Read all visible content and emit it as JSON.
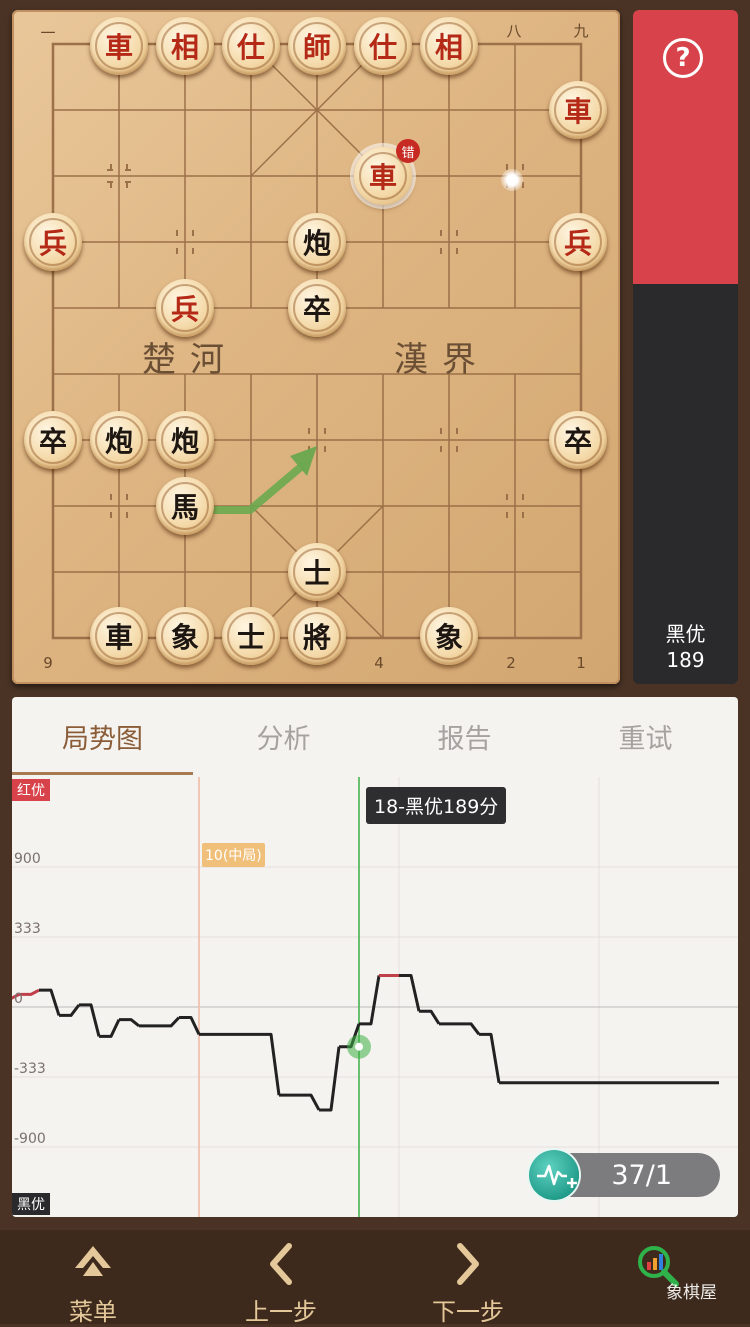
{
  "board": {
    "top_file_labels": [
      "一",
      "八",
      "九"
    ],
    "bottom_file_labels": [
      "9",
      "4",
      "2",
      "1"
    ],
    "river_left": "楚河",
    "river_right": "漢界",
    "error_badge": "错",
    "pieces": {
      "r_top_1": "車",
      "r_top_2": "相",
      "r_top_3": "仕",
      "r_top_4": "師",
      "r_top_5": "仕",
      "r_top_6": "相",
      "r_right_che": "車",
      "r_sel_che": "車",
      "r_left_bing": "兵",
      "r_right_bing": "兵",
      "r_mid_bing": "兵",
      "b_pao_1": "炮",
      "b_zu_1": "卒",
      "b_zu_2": "卒",
      "b_pao_2": "炮",
      "b_pao_3": "炮",
      "b_zu_3": "卒",
      "b_ma": "馬",
      "b_shi_1": "士",
      "b_che": "車",
      "b_xiang_1": "象",
      "b_shi_2": "士",
      "b_jiang": "將",
      "b_xiang_2": "象"
    }
  },
  "sidebar": {
    "help_icon": "?",
    "advantage_label": "黑优",
    "advantage_value": "189",
    "colors": {
      "red": "#d8434b",
      "dark": "#2a2a2c"
    }
  },
  "tabs": [
    "局势图",
    "分析",
    "报告",
    "重试"
  ],
  "chart": {
    "red_adv_tag": "红优",
    "black_adv_tag": "黑优",
    "y_labels": [
      "900",
      "333",
      "0",
      "-333",
      "-900"
    ],
    "tooltip": "18-黑优189分",
    "phase_tag": "10(中局)",
    "counter": "37/1",
    "colors": {
      "red_line": "#c0404a",
      "black_line": "#222222",
      "marker": "#3cb043"
    }
  },
  "chart_data": {
    "type": "line",
    "title": "",
    "xlabel": "",
    "ylabel": "",
    "y_ticks": [
      900,
      333,
      0,
      -333,
      -900
    ],
    "markers": [
      {
        "x": 10,
        "label": "10(中局)"
      },
      {
        "x": 18,
        "label": "18-黑优189分"
      }
    ],
    "series": [
      {
        "x": [
          1,
          2,
          3,
          4,
          5,
          6,
          7,
          8,
          9,
          10,
          11,
          12,
          13,
          14,
          15,
          16,
          17,
          18,
          19,
          20,
          21,
          22,
          23,
          24,
          25,
          26,
          27,
          28,
          29,
          30,
          31,
          32,
          33,
          34,
          35,
          36,
          37
        ],
        "values": [
          40,
          60,
          80,
          -40,
          10,
          -140,
          -60,
          -90,
          -90,
          -50,
          -130,
          -130,
          -130,
          -130,
          -480,
          -480,
          -600,
          -189,
          -80,
          150,
          150,
          -20,
          -80,
          -80,
          -130,
          -380,
          -380,
          -380,
          -380,
          -380,
          -380,
          -380,
          -380,
          -380,
          -380,
          -380,
          -380
        ]
      }
    ]
  },
  "bottom_nav": {
    "menu": "菜单",
    "prev": "上一步",
    "next": "下一步"
  },
  "watermark": "象棋屋"
}
